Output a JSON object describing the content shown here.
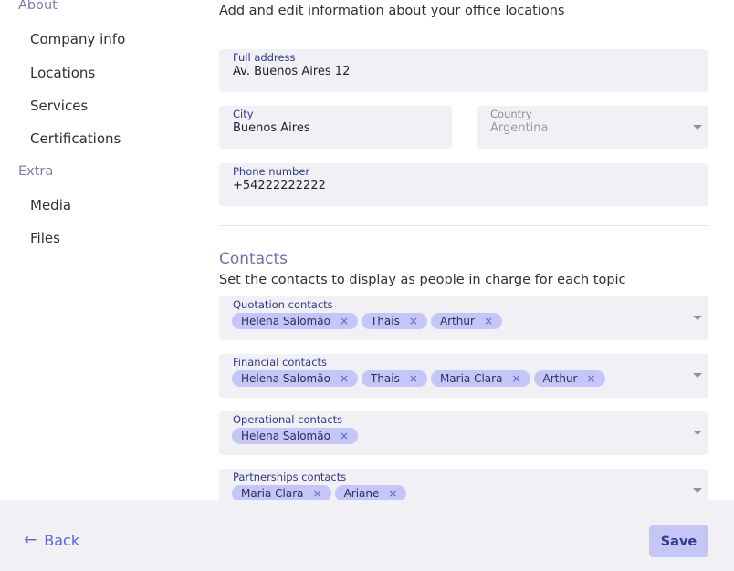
{
  "sidebar": {
    "sections": [
      {
        "title": "About",
        "items": [
          "Company info",
          "Locations",
          "Services",
          "Certifications"
        ]
      },
      {
        "title": "Extra",
        "items": [
          "Media",
          "Files"
        ]
      }
    ]
  },
  "location": {
    "description": "Add and edit information about your office locations",
    "full_address": {
      "label": "Full address",
      "value": "Av. Buenos Aires 12"
    },
    "city": {
      "label": "City",
      "value": "Buenos Aires"
    },
    "country": {
      "label": "Country",
      "value": "Argentina"
    },
    "phone": {
      "label": "Phone number",
      "value": "+54222222222"
    }
  },
  "contacts": {
    "title": "Contacts",
    "description": "Set the contacts to display as people in charge for each topic",
    "groups": [
      {
        "label": "Quotation contacts",
        "chips": [
          "Helena Salomão",
          "Thais",
          "Arthur"
        ]
      },
      {
        "label": "Financial contacts",
        "chips": [
          "Helena Salomão",
          "Thais",
          "Maria Clara",
          "Arthur"
        ]
      },
      {
        "label": "Operational contacts",
        "chips": [
          "Helena Salomão"
        ]
      },
      {
        "label": "Partnerships contacts",
        "chips": [
          "Maria Clara",
          "Ariane"
        ]
      }
    ],
    "remove_glyph": "×"
  },
  "footer": {
    "back_icon": "arrow-left-icon",
    "back_arrow": "←",
    "back_label": "Back",
    "save_label": "Save"
  },
  "colors": {
    "accent": "#5a63d8",
    "chip_bg": "#c4c6f7",
    "field_bg": "#f0f0f5",
    "section_title": "#7d80a8"
  }
}
